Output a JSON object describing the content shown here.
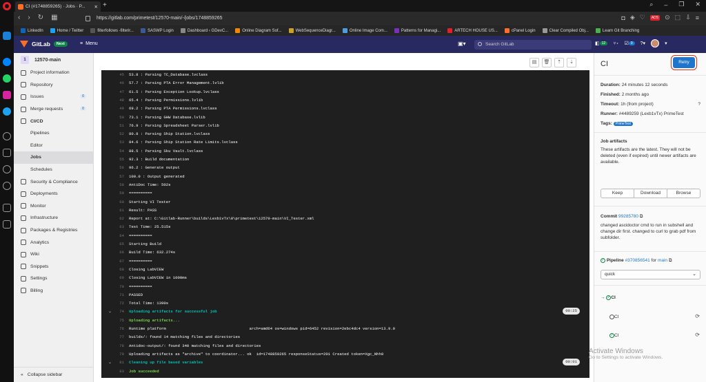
{
  "browser": {
    "tab_title": "CI (#1748859265) · Jobs · P...",
    "url": "https://gitlab.com/primetest/12570-main/-/jobs/1748859265",
    "ad_badge": "ADS",
    "bookmarks": [
      "LinkedIn",
      "Home / Twitter",
      "filterfollows -filterir...",
      "SASWP Login",
      "Dashboard ‹ GDevC...",
      "Online Diagram Sof...",
      "WebSequenceDiagr...",
      "Online Image Com...",
      "Patterns for Managi...",
      "ARTECH HOUSE US...",
      "cPanel Login",
      "Clear Compiled Obj...",
      "Learn Git Branching"
    ]
  },
  "gitlab": {
    "brand": "GitLab",
    "next_badge": "Next",
    "menu_label": "Menu",
    "search_placeholder": "Search GitLab",
    "counts": {
      "issues": "12",
      "mr": "",
      "todos": "9"
    }
  },
  "sidebar": {
    "project_avatar": "1",
    "project_name": "12570-main",
    "items": [
      {
        "label": "Project information",
        "icon": "info-icon"
      },
      {
        "label": "Repository",
        "icon": "repository-icon"
      },
      {
        "label": "Issues",
        "icon": "issues-icon",
        "badge": "0"
      },
      {
        "label": "Merge requests",
        "icon": "merge-request-icon",
        "badge": "0"
      },
      {
        "label": "CI/CD",
        "icon": "rocket-icon"
      }
    ],
    "cicd_sub": [
      "Pipelines",
      "Editor",
      "Jobs",
      "Schedules"
    ],
    "items2": [
      {
        "label": "Security & Compliance",
        "icon": "shield-icon"
      },
      {
        "label": "Deployments",
        "icon": "deployments-icon"
      },
      {
        "label": "Monitor",
        "icon": "monitor-icon"
      },
      {
        "label": "Infrastructure",
        "icon": "cloud-icon"
      },
      {
        "label": "Packages & Registries",
        "icon": "package-icon"
      },
      {
        "label": "Analytics",
        "icon": "chart-icon"
      },
      {
        "label": "Wiki",
        "icon": "book-icon"
      },
      {
        "label": "Snippets",
        "icon": "snippet-icon"
      },
      {
        "label": "Settings",
        "icon": "gear-icon"
      },
      {
        "label": "Billing",
        "icon": "credit-card-icon"
      }
    ],
    "collapse_label": "Collapse sidebar"
  },
  "log": [
    {
      "n": "45",
      "t": "53.8 : Parsing TC_Database.lvclass"
    },
    {
      "n": "46",
      "t": "57.7 : Parsing PTA Error Management.lvlib"
    },
    {
      "n": "47",
      "t": "61.5 : Parsing Exception Lookup.lvclass"
    },
    {
      "n": "48",
      "t": "65.4 : Parsing Permissions.lvlib"
    },
    {
      "n": "49",
      "t": "69.2 : Parsing PTA Permissions.lvclass"
    },
    {
      "n": "50",
      "t": "73.1 : Parsing GHW Database.lvlib"
    },
    {
      "n": "51",
      "t": "76.9 : Parsing Spreadsheet Parser.lvlib"
    },
    {
      "n": "52",
      "t": "80.8 : Parsing Ship Station.lvclass"
    },
    {
      "n": "53",
      "t": "84.6 : Parsing Ship Station Rate Limits.lvclass"
    },
    {
      "n": "54",
      "t": "88.5 : Parsing Sku Vault.lvclass"
    },
    {
      "n": "55",
      "t": "92.3 : Build documentation"
    },
    {
      "n": "56",
      "t": "96.2 : Generate output"
    },
    {
      "n": "57",
      "t": "100.0 : Output generated"
    },
    {
      "n": "58",
      "t": "AntiDoc Time: 502s"
    },
    {
      "n": "59",
      "t": "=========="
    },
    {
      "n": "60",
      "t": "Starting VI Tester"
    },
    {
      "n": "61",
      "t": "Result: PASS"
    },
    {
      "n": "62",
      "t": "Report at: C:\\Gitlab-Runner\\builds\\Lexb1vTx\\0\\primetest\\12570-main\\VI_Tester.xml"
    },
    {
      "n": "63",
      "t": "Test Time: 25.515s"
    },
    {
      "n": "64",
      "t": "=========="
    },
    {
      "n": "65",
      "t": "Starting Build"
    },
    {
      "n": "66",
      "t": "Build Time: 632.274s"
    },
    {
      "n": "67",
      "t": "=========="
    },
    {
      "n": "68",
      "t": "Closing LabVIEW"
    },
    {
      "n": "69",
      "t": "Closing LabVIEW in 1000ms"
    },
    {
      "n": "70",
      "t": "=========="
    },
    {
      "n": "71",
      "t": "PASSED"
    },
    {
      "n": "72",
      "t": "Total Time: 1390s"
    },
    {
      "n": "74",
      "t": "Uploading artifacts for successful job",
      "kind": "sect",
      "dur": "00:25"
    },
    {
      "n": "75",
      "t": "Uploading artifacts...",
      "kind": "green"
    },
    {
      "n": "76",
      "t": "Runtime platform                                    arch=amd64 os=windows pid=6452 revision=2ebc4dc4 version=13.9.0"
    },
    {
      "n": "77",
      "t": "builds/: found 14 matching files and directories"
    },
    {
      "n": "78",
      "t": "Antidoc-output/: found 340 matching files and directories"
    },
    {
      "n": "79",
      "t": "Uploading artifacts as \"archive\" to coordinator... ok  id=1748859265 responseStatus=201 Created token=Xgc_Nhh9"
    },
    {
      "n": "81",
      "t": "Cleaning up file based variables",
      "kind": "sect",
      "dur": "00:01"
    },
    {
      "n": "83",
      "t": "Job succeeded",
      "kind": "green"
    }
  ],
  "panel": {
    "title": "CI",
    "retry": "Retry",
    "duration_label": "Duration:",
    "duration": "24 minutes 12 seconds",
    "finished_label": "Finished:",
    "finished": "2 months ago",
    "timeout_label": "Timeout:",
    "timeout": "1h (from project)",
    "runner_label": "Runner:",
    "runner": "#4489259 (Lexb1vTx) PrimeTest",
    "tags_label": "Tags:",
    "tag": "PrimeTest",
    "artifacts_title": "Job artifacts",
    "artifacts_text": "These artifacts are the latest. They will not be deleted (even if expired) until newer artifacts are available.",
    "keep": "Keep",
    "download": "Download",
    "browse": "Browse",
    "commit_label": "Commit",
    "commit_hash": "99285780",
    "commit_msg": "changed ascidoctor cmd to run in subshell and change dir first. changed to curl to grab pdf from subfolder.",
    "pipeline_label": "Pipeline",
    "pipeline_id": "#370856541",
    "pipeline_for": "for",
    "branch": "main",
    "stage": "quick",
    "jobs": [
      "CI",
      "CI",
      "CI"
    ]
  },
  "watermark": {
    "line1": "Activate Windows",
    "line2": "Go to Settings to activate Windows."
  }
}
